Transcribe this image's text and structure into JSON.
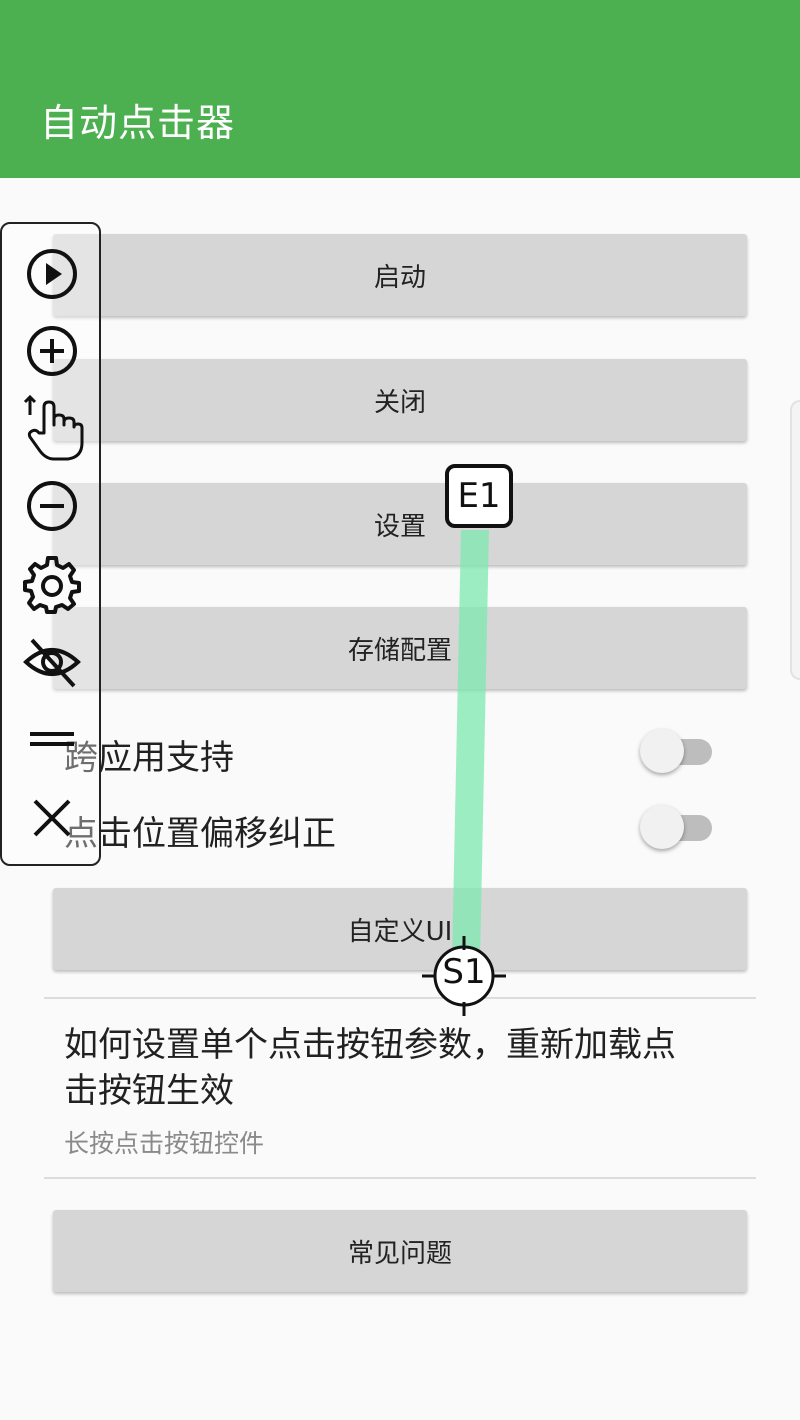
{
  "appbar": {
    "title": "自动点击器"
  },
  "buttons": {
    "start": "启动",
    "close": "关闭",
    "settings": "设置",
    "save_config": "存储配置",
    "custom_ui": "自定义UI",
    "faq": "常见问题"
  },
  "toggles": [
    {
      "label": "跨应用支持",
      "on": false
    },
    {
      "label": "点击位置偏移纠正",
      "on": false
    }
  ],
  "help": {
    "title": "如何设置单个点击按钮参数，重新加载点击按钮生效",
    "subtitle": "长按点击按钮控件"
  },
  "toolbar": {
    "icons": [
      "play-icon",
      "add-icon",
      "swipe-hand-icon",
      "remove-icon",
      "gear-icon",
      "eye-off-icon",
      "drag-handle-icon",
      "close-icon"
    ]
  },
  "overlay": {
    "end_label": "E1",
    "start_label": "S1",
    "swipe_color": "#7ee8b0"
  },
  "colors": {
    "appbar": "#4caf50",
    "button_bg": "#d6d6d6"
  }
}
